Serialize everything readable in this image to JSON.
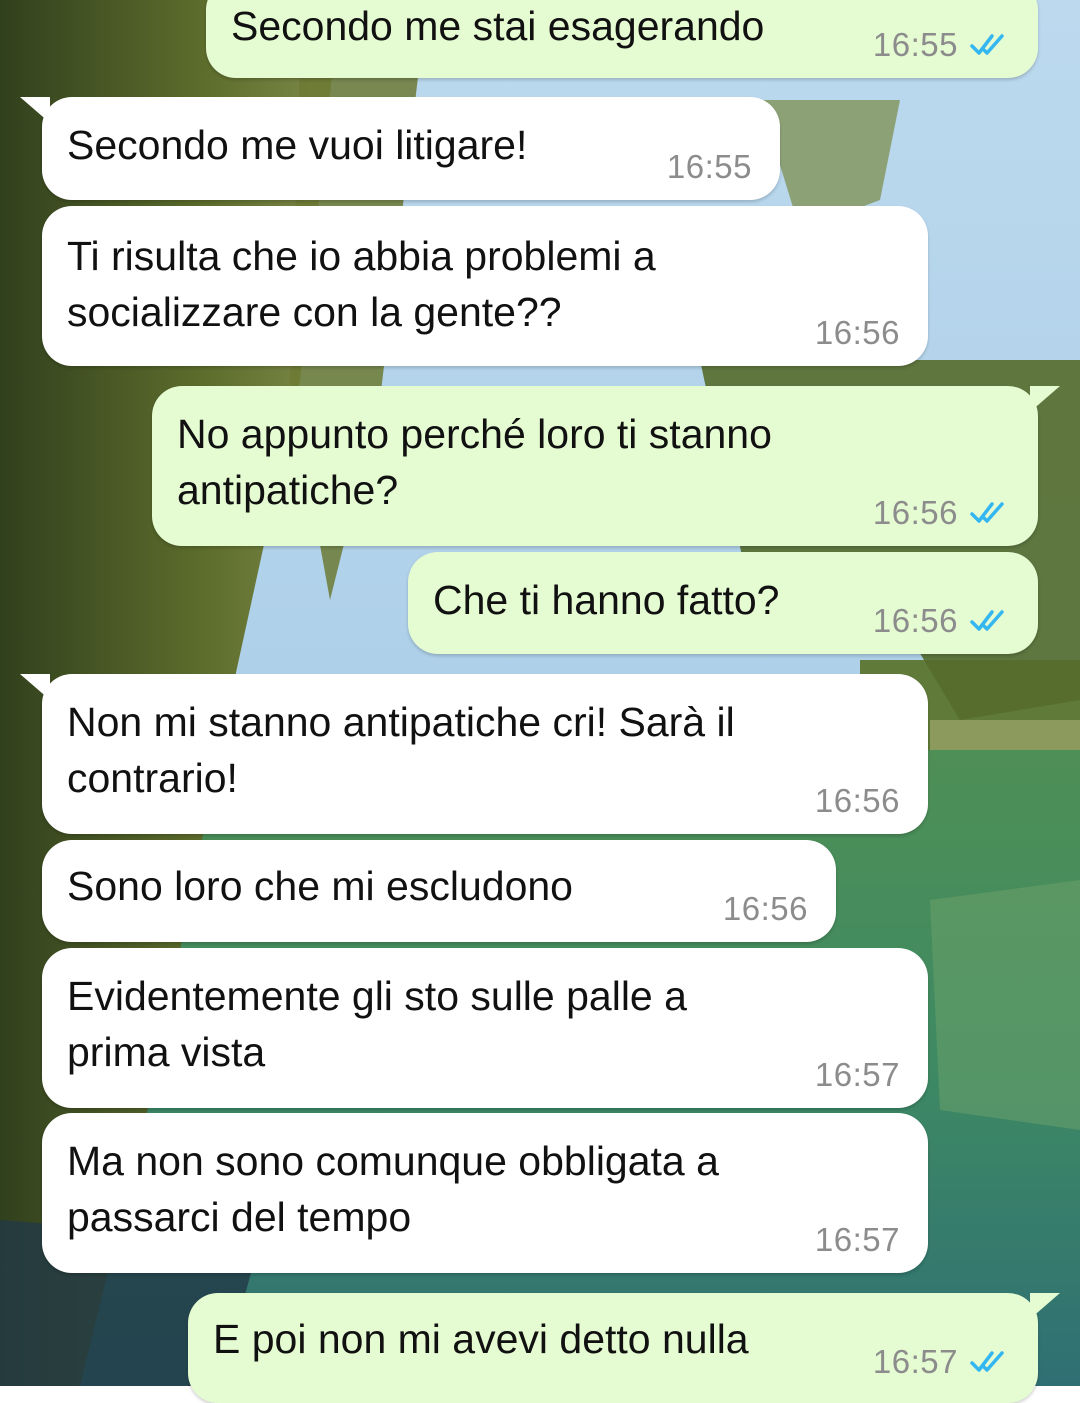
{
  "colors": {
    "incoming_bubble": "#ffffff",
    "outgoing_bubble": "#e5fbd2",
    "text": "#111111",
    "time": "#8c8c8c",
    "read_ticks": "#34b7f1"
  },
  "icons": {
    "read_receipt": "double-check-icon"
  },
  "messages": [
    {
      "direction": "outgoing",
      "text": "Secondo me stai esagerando",
      "time": "16:55",
      "status": "read"
    },
    {
      "direction": "incoming",
      "text": "Secondo me vuoi litigare!",
      "time": "16:55"
    },
    {
      "direction": "incoming",
      "text": "Ti risulta che io abbia problemi a\nsocializzare con la gente??",
      "time": "16:56"
    },
    {
      "direction": "outgoing",
      "text": "No appunto perché loro ti stanno\nantipatiche?",
      "time": "16:56",
      "status": "read"
    },
    {
      "direction": "outgoing",
      "text": "Che ti hanno fatto?",
      "time": "16:56",
      "status": "read"
    },
    {
      "direction": "incoming",
      "text": "Non mi stanno antipatiche cri! Sarà il\ncontrario!",
      "time": "16:56"
    },
    {
      "direction": "incoming",
      "text": "Sono loro che mi escludono",
      "time": "16:56"
    },
    {
      "direction": "incoming",
      "text": "Evidentemente gli sto sulle palle a\nprima vista",
      "time": "16:57"
    },
    {
      "direction": "incoming",
      "text": "Ma non sono comunque obbligata a\npassarci del tempo",
      "time": "16:57"
    },
    {
      "direction": "outgoing",
      "text": "E poi non mi avevi detto nulla",
      "time": "16:57",
      "status": "read"
    }
  ]
}
